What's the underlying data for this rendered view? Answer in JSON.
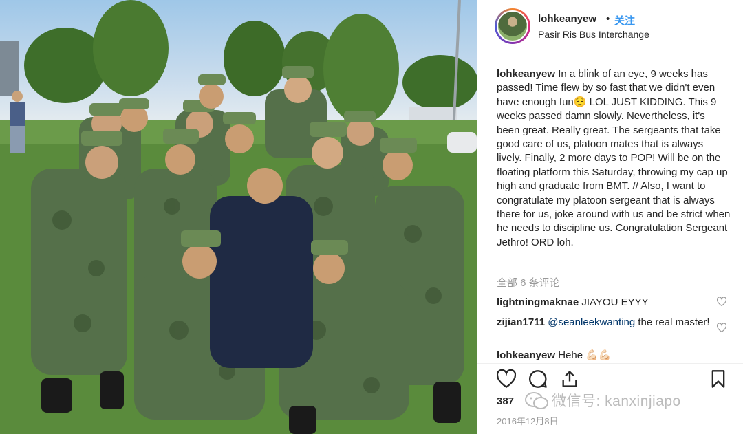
{
  "post": {
    "username": "lohkeanyew",
    "follow_label": "关注",
    "separator": "•",
    "location": "Pasir Ris Bus Interchange",
    "caption": "In a blink of an eye, 9 weeks has passed! Time flew by so fast that we didn't even have enough fun😌  LOL JUST KIDDING. This 9 weeks passed damn slowly. Nevertheless, it's been great. Really great. The sergeants that take good care of us, platoon mates that is always lively. Finally, 2 more days to POP! Will be on the floating platform this Saturday, throwing my cap up high and graduate from BMT. // Also, I want to congratulate my platoon sergeant that is always there for us, joke around with us and be strict when he needs to discipline us. Congratulation Sergeant Jethro! ORD loh.",
    "view_all_comments": "全部 6 条评论",
    "likes": "387",
    "date": "2016年12月8日",
    "watermark": "微信号: kanxinjiapo"
  },
  "comments": [
    {
      "user": "lightningmaknae",
      "text": "JIAYOU EYYY",
      "mention": ""
    },
    {
      "user": "zijian1711",
      "mention": "@seanleekwanting",
      "text": "the real master!"
    },
    {
      "user": "lohkeanyew",
      "text": "Hehe 💪🏻💪🏻",
      "mention": ""
    }
  ],
  "icons": [
    "heart-icon",
    "comment-icon",
    "share-icon",
    "bookmark-icon",
    "wechat-logo-icon"
  ],
  "colors": {
    "follow": "#3897f0",
    "mention": "#003569",
    "muted": "#999999",
    "uniform": "#4f6b3d"
  }
}
